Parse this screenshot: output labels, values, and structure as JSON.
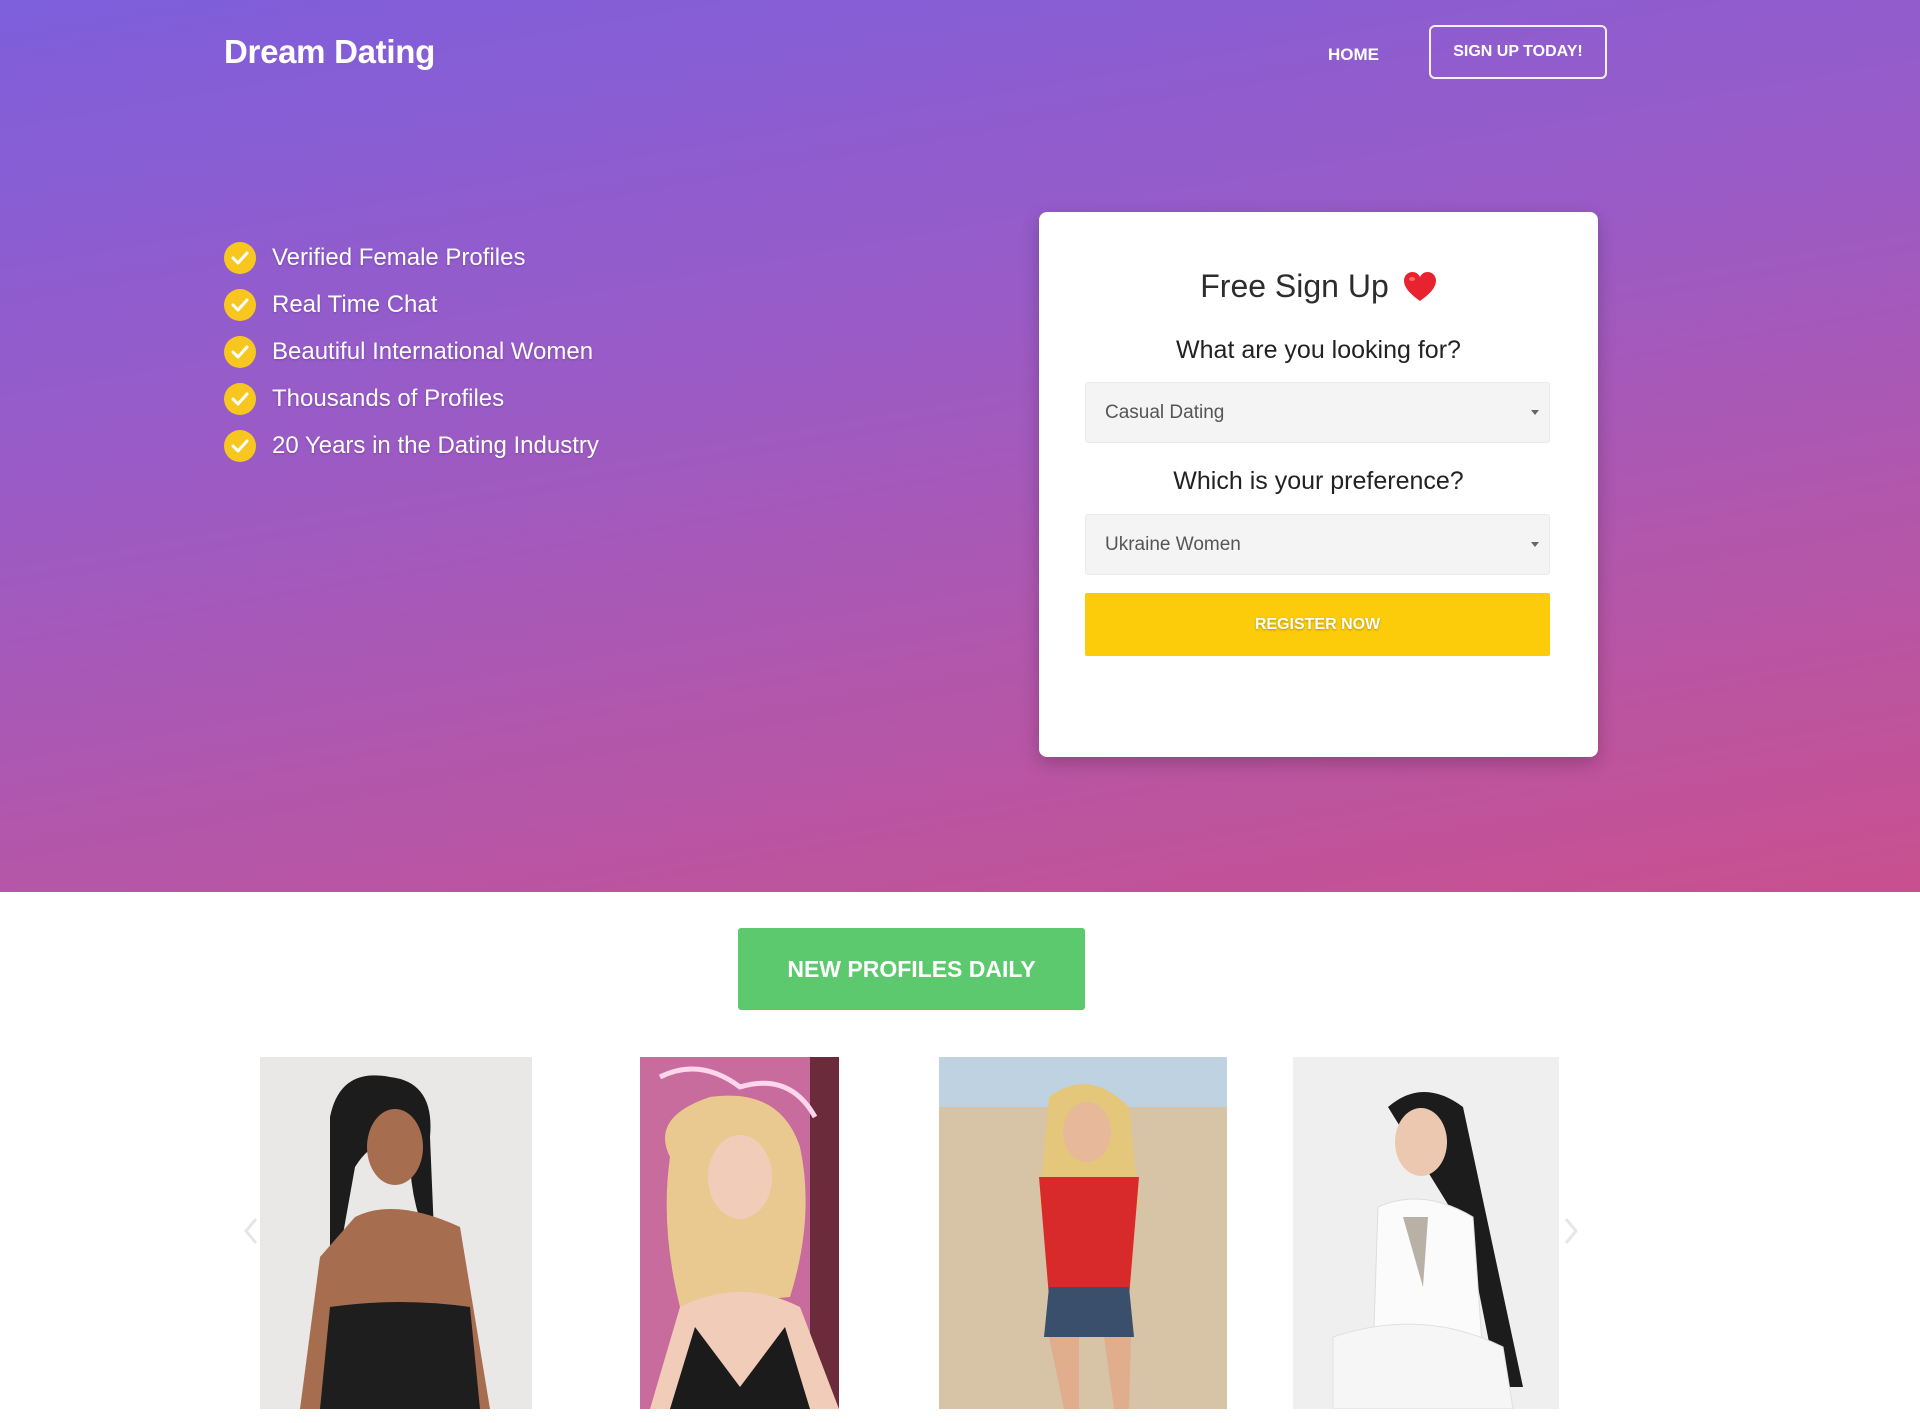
{
  "header": {
    "logo": "Dream Dating",
    "nav": {
      "home": "HOME",
      "signup": "SIGN UP TODAY!"
    }
  },
  "features": [
    {
      "icon": "check-circle-icon",
      "text": "Verified Female Profiles"
    },
    {
      "icon": "check-circle-icon",
      "text": "Real Time Chat"
    },
    {
      "icon": "check-circle-icon",
      "text": "Beautiful International Women"
    },
    {
      "icon": "check-circle-icon",
      "text": "Thousands of Profiles"
    },
    {
      "icon": "check-circle-icon",
      "text": "20 Years in the Dating Industry"
    }
  ],
  "signup_form": {
    "title": "Free Sign Up",
    "title_icon": "heart-icon",
    "looking_for_label": "What are you looking for?",
    "looking_for_value": "Casual Dating",
    "preference_label": "Which is your preference?",
    "preference_value": "Ukraine Women",
    "submit": "REGISTER NOW"
  },
  "profiles_section": {
    "badge": "NEW PROFILES DAILY",
    "carousel": {
      "prev_icon": "chevron-left-icon",
      "next_icon": "chevron-right-icon",
      "slides": 4
    }
  },
  "colors": {
    "hero_gradient_start": "#7e5fdc",
    "hero_gradient_end": "#c9508f",
    "check": "#f8c71f",
    "register_button": "#fccc0a",
    "badge": "#5dc96e",
    "heart": "#e8222e"
  }
}
